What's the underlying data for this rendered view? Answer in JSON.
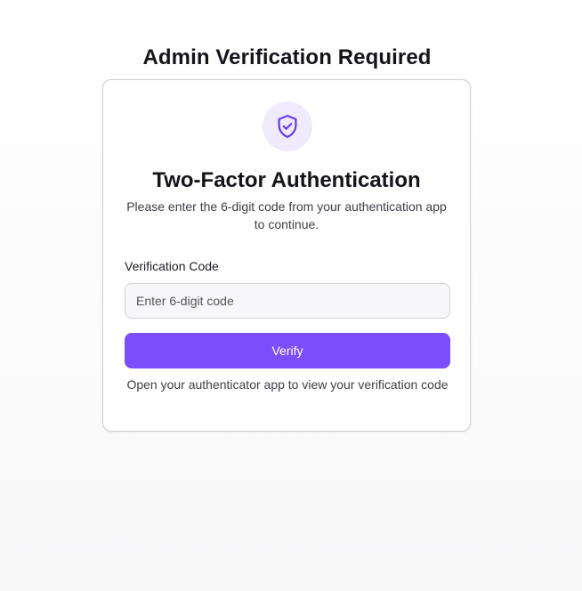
{
  "page": {
    "title": "Admin Verification Required"
  },
  "card": {
    "icon": "shield-check-icon",
    "title": "Two-Factor Authentication",
    "description": "Please enter the 6-digit code from your authentication app to continue.",
    "field_label": "Verification Code",
    "input_value": "",
    "input_placeholder": "Enter 6-digit code",
    "verify_label": "Verify",
    "helper_text": "Open your authenticator app to view your verification code"
  },
  "colors": {
    "accent": "#7c4dfa",
    "icon_badge_bg": "#efebfd",
    "icon_stroke": "#6a3df0"
  }
}
